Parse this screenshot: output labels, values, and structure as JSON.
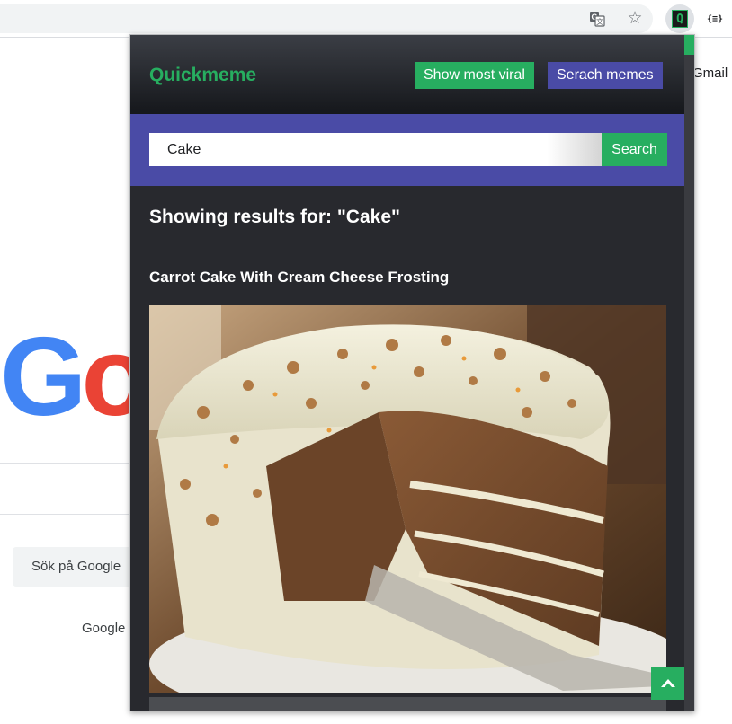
{
  "browser": {
    "extension_icon": "quickmeme-extension-icon",
    "json_icon_label": "{≡}"
  },
  "google_page": {
    "gmail_link": "Gmail",
    "logo_text_partial": "Go",
    "search_button_label": "Sök på Google",
    "footer_text": "Google"
  },
  "popup": {
    "brand_name": "Quickmeme",
    "show_most_viral_label": "Show most viral",
    "search_memes_label": "Serach memes",
    "search": {
      "value": "Cake",
      "button_label": "Search"
    },
    "results_heading": "Showing results for: \"Cake\"",
    "results": [
      {
        "title": "Carrot Cake With Cream Cheese Frosting",
        "image": "carrot-cake-photo"
      }
    ],
    "scroll_top_icon": "arrow-up-icon"
  },
  "colors": {
    "accent_green": "#27ae60",
    "accent_purple": "#4a4ba6",
    "popup_background": "#28292e"
  }
}
